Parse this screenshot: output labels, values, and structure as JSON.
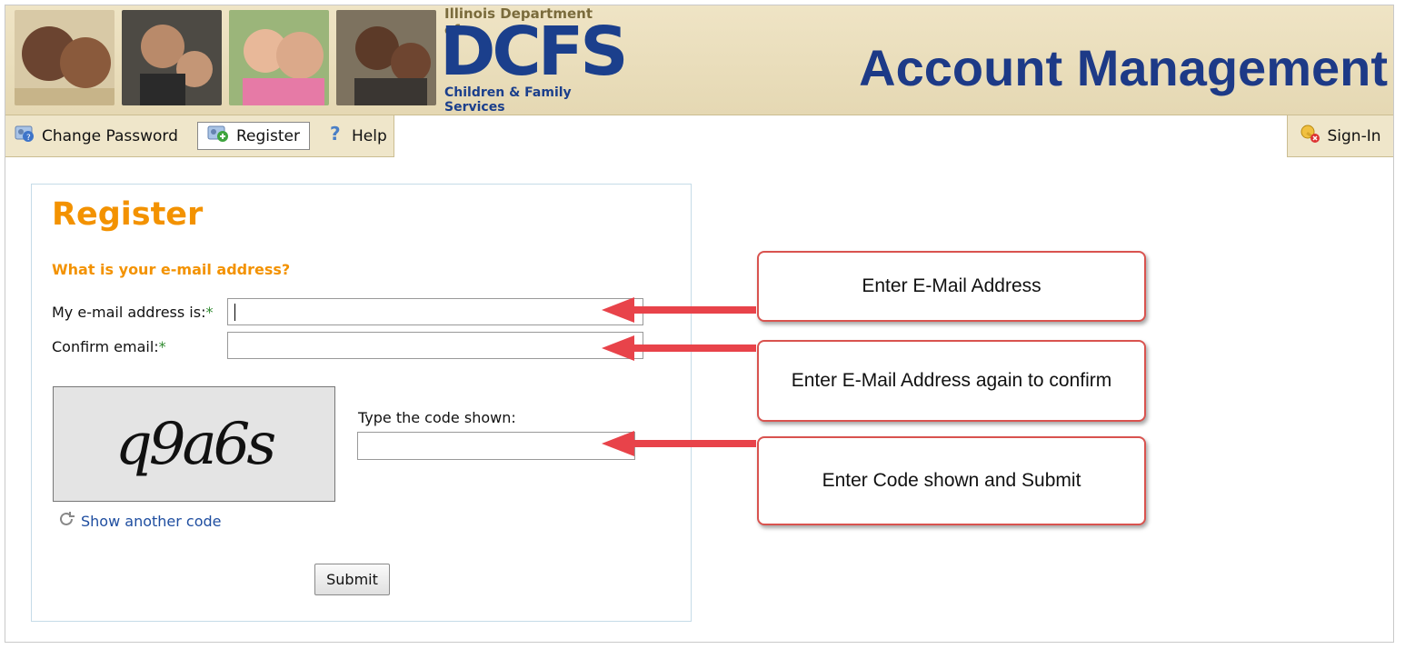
{
  "header": {
    "logo_top": "Illinois Department of",
    "logo_main": "DCFS",
    "logo_sub": "Children & Family Services",
    "title": "Account Management",
    "colors": {
      "banner": "#e8dcbb",
      "title": "#1d3a87",
      "logo": "#1b3f8c"
    }
  },
  "nav": {
    "change_password": "Change Password",
    "register": "Register",
    "help": "Help",
    "sign_in": "Sign-In"
  },
  "form": {
    "heading": "Register",
    "question": "What is your e-mail address?",
    "email_label": "My e-mail address is:",
    "confirm_label": "Confirm email:",
    "required_mark": "*",
    "email_value": "",
    "confirm_value": "",
    "captcha_text": "q9a6s",
    "code_label": "Type the code shown:",
    "code_value": "",
    "another_code": "Show another code",
    "submit": "Submit",
    "colors": {
      "heading": "#f39200",
      "link": "#1f4ea0",
      "required": "#2f8a2f"
    }
  },
  "callouts": {
    "email": "Enter E-Mail Address",
    "confirm": "Enter E-Mail Address again to confirm",
    "code": "Enter Code shown and Submit",
    "colors": {
      "border": "#d9534f",
      "arrow": "#e8434a"
    }
  }
}
